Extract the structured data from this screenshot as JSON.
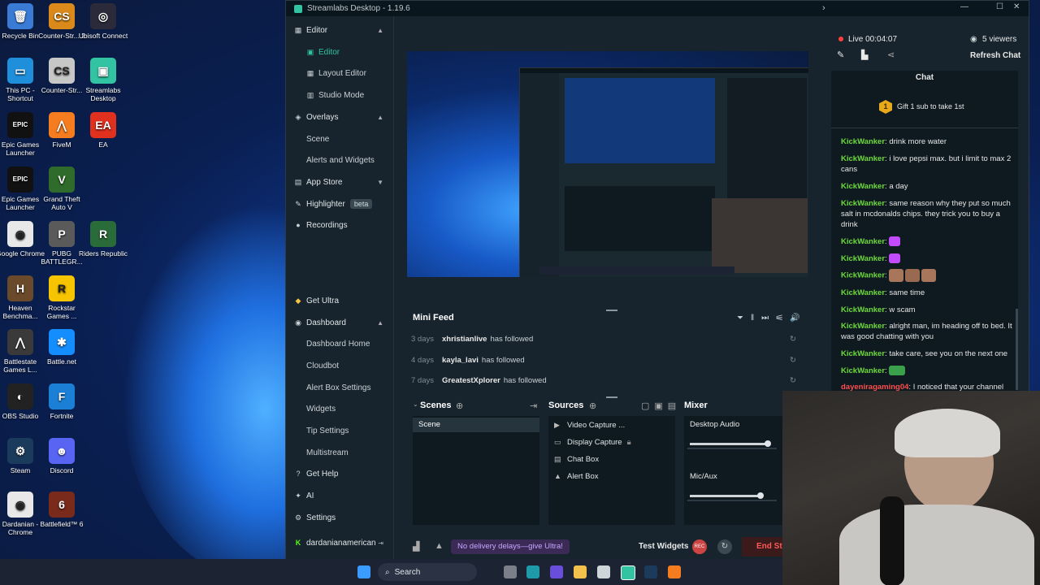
{
  "desktop_icons": [
    {
      "name": "recycle-bin-icon",
      "label": "Recycle Bin",
      "color": "#3a7bd5",
      "glyph": "🗑"
    },
    {
      "name": "counter-strike-2-icon",
      "label": "Counter-Str... 2",
      "color": "#d98a1a",
      "glyph": "CS"
    },
    {
      "name": "ubisoft-connect-icon",
      "label": "Ubisoft Connect",
      "color": "#2a2a3a",
      "glyph": "◎"
    },
    {
      "name": "this-pc-icon",
      "label": "This PC - Shortcut",
      "color": "#1f8fdc",
      "glyph": "▭"
    },
    {
      "name": "counter-strike-icon",
      "label": "Counter-Str...",
      "color": "#c7c7c7",
      "glyph": "CS"
    },
    {
      "name": "streamlabs-desktop-icon",
      "label": "Streamlabs Desktop",
      "color": "#31c3a2",
      "glyph": "▣"
    },
    {
      "name": "epic-games-icon",
      "label": "Epic Games Launcher",
      "color": "#111111",
      "glyph": "EPIC"
    },
    {
      "name": "fivem-icon",
      "label": "FiveM",
      "color": "#f57c1f",
      "glyph": "⋀"
    },
    {
      "name": "ea-icon",
      "label": "EA",
      "color": "#e0311f",
      "glyph": "EA"
    },
    {
      "name": "epic-games-2-icon",
      "label": "Epic Games Launcher",
      "color": "#111111",
      "glyph": "EPIC"
    },
    {
      "name": "gta-v-icon",
      "label": "Grand Theft Auto V",
      "color": "#2f6b2a",
      "glyph": "V"
    },
    {
      "name": "google-chrome-icon",
      "label": "Google Chrome",
      "color": "#e8e8e8",
      "glyph": "◉"
    },
    {
      "name": "pubg-icon",
      "label": "PUBG BATTLEGR...",
      "color": "#5a5a5a",
      "glyph": "P"
    },
    {
      "name": "riders-republic-icon",
      "label": "Riders Republic",
      "color": "#2a6b3a",
      "glyph": "R"
    },
    {
      "name": "heaven-benchmark-icon",
      "label": "Heaven Benchma...",
      "color": "#6a4a2a",
      "glyph": "H"
    },
    {
      "name": "rockstar-icon",
      "label": "Rockstar Games ...",
      "color": "#f6c400",
      "glyph": "R"
    },
    {
      "name": "battlestate-icon",
      "label": "Battlestate Games L...",
      "color": "#3a3a3a",
      "glyph": "⋀"
    },
    {
      "name": "battlenet-icon",
      "label": "Battle.net",
      "color": "#148eff",
      "glyph": "✱"
    },
    {
      "name": "obs-studio-icon",
      "label": "OBS Studio",
      "color": "#222222",
      "glyph": "◐"
    },
    {
      "name": "fortnite-icon",
      "label": "Fortnite",
      "color": "#1b7fd6",
      "glyph": "F"
    },
    {
      "name": "steam-icon",
      "label": "Steam",
      "color": "#1b3b5c",
      "glyph": "⚙"
    },
    {
      "name": "discord-icon",
      "label": "Discord",
      "color": "#5865f2",
      "glyph": "☻"
    },
    {
      "name": "chrome-profile-icon",
      "label": "Dardanian - Chrome",
      "color": "#e8e8e8",
      "glyph": "◉"
    },
    {
      "name": "battlefield-6-icon",
      "label": "Battlefield™ 6",
      "color": "#7a2a1a",
      "glyph": "6"
    }
  ],
  "window": {
    "title": "Streamlabs Desktop - 1.19.6",
    "controls": [
      "—",
      "☐",
      "✕"
    ]
  },
  "sidebar": {
    "editor_group": "Editor",
    "editor": "Editor",
    "layout_editor": "Layout Editor",
    "studio_mode": "Studio Mode",
    "overlays": "Overlays",
    "scene": "Scene",
    "alerts_widgets": "Alerts and Widgets",
    "app_store": "App Store",
    "highlighter": "Highlighter",
    "beta": "beta",
    "recordings": "Recordings",
    "get_ultra": "Get Ultra",
    "dashboard": "Dashboard",
    "dashboard_home": "Dashboard Home",
    "cloudbot": "Cloudbot",
    "alert_box_settings": "Alert Box Settings",
    "widgets": "Widgets",
    "tip_settings": "Tip Settings",
    "multistream": "Multistream",
    "get_help": "Get Help",
    "ai": "AI",
    "settings": "Settings",
    "username": "dardanianamerican"
  },
  "mini_feed": {
    "title": "Mini Feed",
    "rows": [
      {
        "age": "3 days",
        "name": "xhristianlive",
        "action": "has followed"
      },
      {
        "age": "4 days",
        "name": "kayla_lavi",
        "action": "has followed"
      },
      {
        "age": "7 days",
        "name": "GreatestXplorer",
        "action": "has followed"
      }
    ]
  },
  "scenes": {
    "title": "Scenes",
    "items": [
      "Scene"
    ]
  },
  "sources": {
    "title": "Sources",
    "items": [
      {
        "label": "Video Capture ...",
        "icon": "camera-icon"
      },
      {
        "label": "Display Capture",
        "icon": "monitor-icon"
      },
      {
        "label": "Chat Box",
        "icon": "chat-icon"
      },
      {
        "label": "Alert Box",
        "icon": "bell-icon"
      }
    ]
  },
  "mixer": {
    "title": "Mixer",
    "channels": [
      {
        "label": "Desktop Audio",
        "level": 0.92
      },
      {
        "label": "Mic/Aux",
        "level": 0.86
      }
    ]
  },
  "footer": {
    "promo": "No delivery delays—give Ultra!",
    "test_widgets": "Test Widgets",
    "rec": "REC",
    "end_stream": "End Str"
  },
  "chat": {
    "live": "Live 00:04:07",
    "viewers": "5 viewers",
    "refresh": "Refresh Chat",
    "title": "Chat",
    "gift_badge": "1",
    "gift_text": "Gift 1 sub to take 1st",
    "messages": [
      {
        "user": "KickWanker",
        "text": "drink more water"
      },
      {
        "user": "KickWanker",
        "text": "i love pepsi max. but i limit to max 2 cans"
      },
      {
        "user": "KickWanker",
        "text": "a day"
      },
      {
        "user": "KickWanker",
        "text": "same reason why they put so much salt in mcdonalds chips. they trick you to buy a drink"
      },
      {
        "user": "KickWanker",
        "text": ""
      },
      {
        "user": "KickWanker",
        "text": ""
      },
      {
        "user": "KickWanker",
        "text": ""
      },
      {
        "user": "KickWanker",
        "text": "same time"
      },
      {
        "user": "KickWanker",
        "text": "w scam"
      },
      {
        "user": "KickWanker",
        "text": "alright man, im heading off to bed. It was good chatting with you"
      },
      {
        "user": "KickWanker",
        "text": "take care, see you on the next one"
      },
      {
        "user": "KickWanker",
        "text": ""
      },
      {
        "user": "dayeniragaming04",
        "text": "I noticed that your channel"
      }
    ]
  },
  "taskbar": {
    "search": "Search"
  }
}
